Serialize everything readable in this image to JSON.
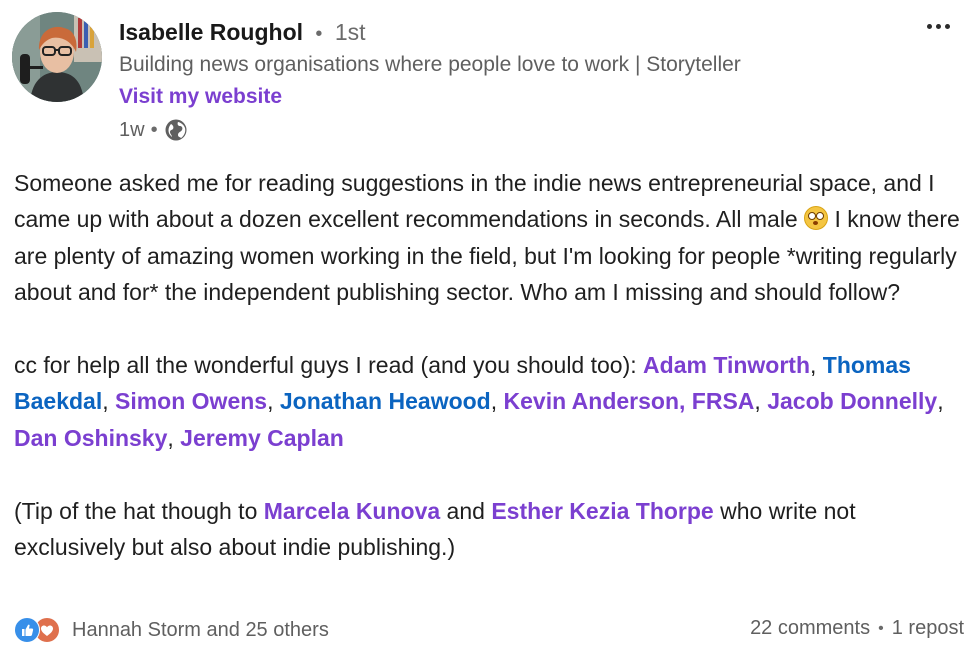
{
  "author": {
    "name": "Isabelle Roughol",
    "separator": "•",
    "degree": "1st",
    "headline": "Building news organisations where people love to work | Storyteller",
    "website_label": "Visit my website",
    "time": "1w",
    "visibility_icon": "globe-icon"
  },
  "menu": {
    "icon": "more-horizontal-icon"
  },
  "post": {
    "p1": {
      "before_emoji": "Someone asked me for reading suggestions in the indie news entrepreneurial space, and I came up with about a dozen excellent recommendations in seconds. All male ",
      "emoji": "flushed-face-emoji",
      "after_emoji": " I know there are plenty of amazing women working in the field, but I'm looking for people *writing regularly about and for* the independent publishing sector. Who am I missing and should follow?"
    },
    "p2": {
      "intro": "cc for help all the wonderful guys I read (and you should too): ",
      "sep": ", ",
      "mentions": [
        "Adam Tinworth",
        "Thomas Baekdal",
        "Simon Owens",
        "Jonathan Heawood",
        "Kevin Anderson, FRSA",
        "Jacob Donnelly",
        "Dan Oshinsky",
        "Jeremy Caplan"
      ]
    },
    "p3": {
      "before": "(Tip of the hat though to ",
      "mention1": "Marcela Kunova",
      "and": " and ",
      "mention2": "Esther Kezia Thorpe",
      "after": " who write not exclusively but also about indie publishing.)"
    }
  },
  "footer": {
    "reactions_text": "Hannah Storm and 25 others",
    "reaction_icons": [
      "like-icon",
      "love-icon"
    ],
    "comments": "22 comments",
    "separator": "•",
    "reposts": "1 repost"
  },
  "colors": {
    "mention_purple": "#7b3fd0",
    "mention_blue": "#0b64c0",
    "secondary_text": "#5f5f5f",
    "like_blue": "#378fe9",
    "love_orange": "#df704d"
  }
}
